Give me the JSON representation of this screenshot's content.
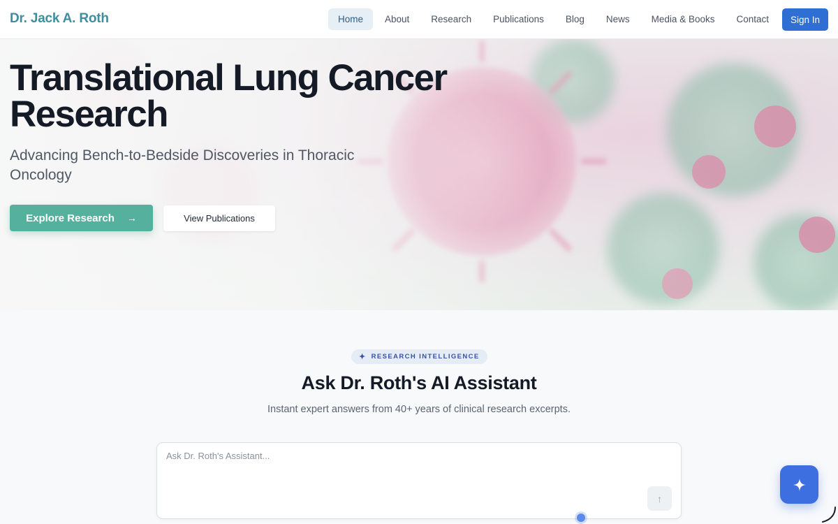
{
  "brand": {
    "name": "Dr. Jack A. Roth",
    "color": "#3e8e9e"
  },
  "nav": {
    "items": [
      {
        "label": "Home",
        "active": true
      },
      {
        "label": "About"
      },
      {
        "label": "Research"
      },
      {
        "label": "Publications"
      },
      {
        "label": "Blog"
      },
      {
        "label": "News"
      },
      {
        "label": "Media & Books"
      },
      {
        "label": "Contact"
      }
    ],
    "signin_label": "Sign In"
  },
  "hero": {
    "title_line1": "Translational Lung Cancer",
    "title_line2": "Research",
    "subtitle": "Advancing Bench-to-Bedside Discoveries in Thoracic Oncology",
    "primary_button": "Explore Research",
    "secondary_button": "View Publications",
    "background_icon": "virus-particles-image"
  },
  "assistant": {
    "badge": "RESEARCH INTELLIGENCE",
    "title": "Ask Dr. Roth's AI Assistant",
    "subtitle": "Instant expert answers from 40+ years of clinical research excerpts.",
    "placeholder": "Ask Dr. Roth's Assistant...",
    "send_icon": "arrow-up-icon"
  },
  "fab": {
    "icon": "sparkle-icon"
  },
  "colors": {
    "accent": "#56b09e",
    "primary": "#2f6fd4",
    "fab": "#3d6fe0"
  }
}
